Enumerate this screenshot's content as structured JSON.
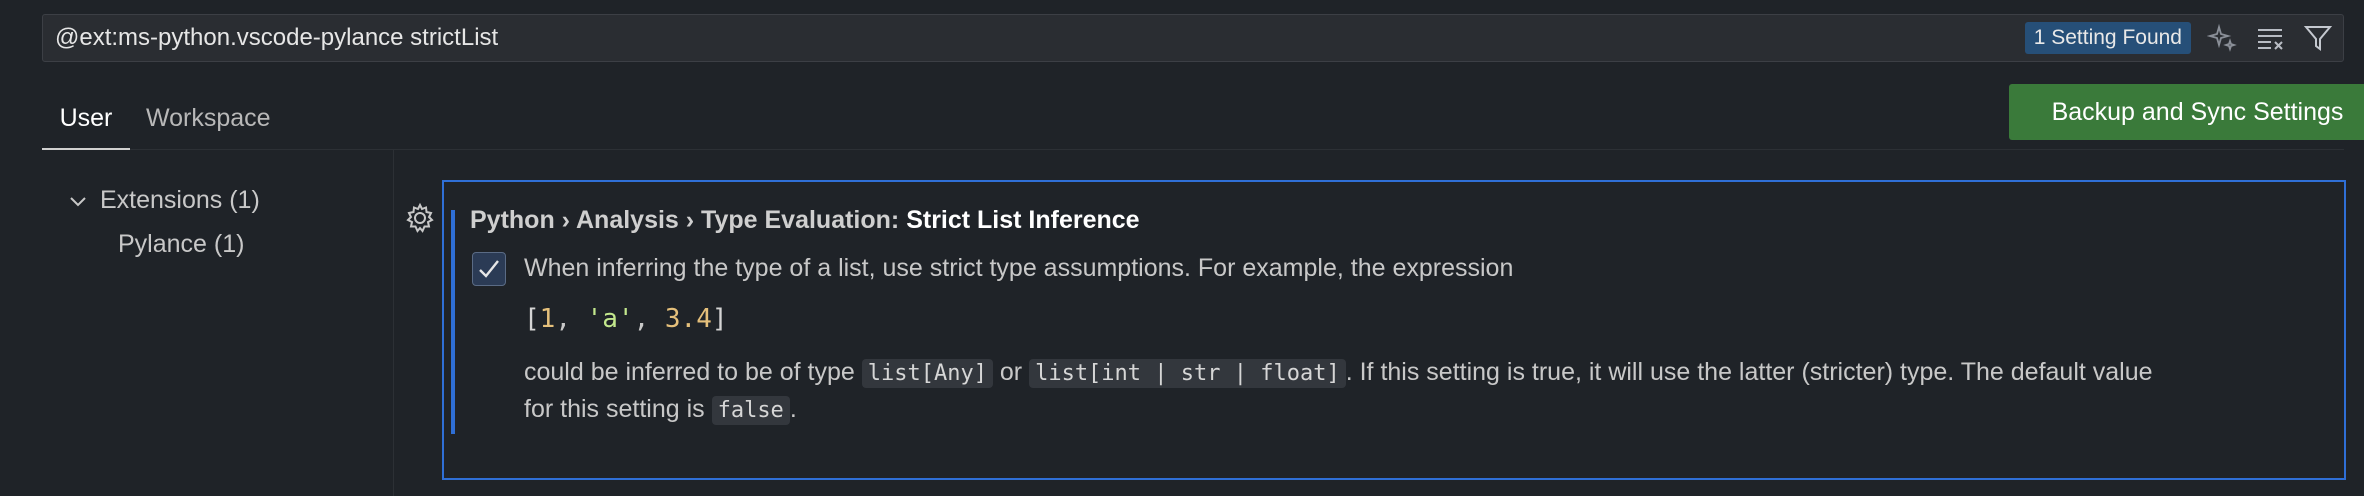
{
  "search": {
    "value": "@ext:ms-python.vscode-pylance strictList",
    "badge": "1 Setting Found"
  },
  "tabs": [
    {
      "label": "User",
      "active": true
    },
    {
      "label": "Workspace",
      "active": false
    }
  ],
  "sync_button": {
    "label": "Backup and Sync Settings"
  },
  "tree": {
    "extensions": "Extensions (1)",
    "pylance": "Pylance (1)"
  },
  "setting": {
    "breadcrumb": "Python › Analysis › Type Evaluation: ",
    "name": "Strict List Inference",
    "checked": true,
    "desc1": "When inferring the type of a list, use strict type assumptions. For example, the expression",
    "code": {
      "open": "[",
      "n1": "1",
      "sep1": ", ",
      "s1": "'a'",
      "sep2": ", ",
      "n2": "3.4",
      "close": "]"
    },
    "desc2_a": "could be inferred to be of type ",
    "code_any": "list[Any]",
    "desc2_b": " or ",
    "code_union": "list[int | str | float]",
    "desc2_c": ". If this setting is true, it will use the latter (stricter) type. The default value",
    "desc3_a": "for this setting is ",
    "code_false": "false",
    "desc3_b": "."
  },
  "colors": {
    "accent": "#2f6fd6",
    "sync_button": "#3a7a3a",
    "badge": "#264f78"
  },
  "icons": [
    "sparkle-icon",
    "clear-filter-icon",
    "filter-icon",
    "chevron-down-icon",
    "gear-icon",
    "check-icon"
  ]
}
